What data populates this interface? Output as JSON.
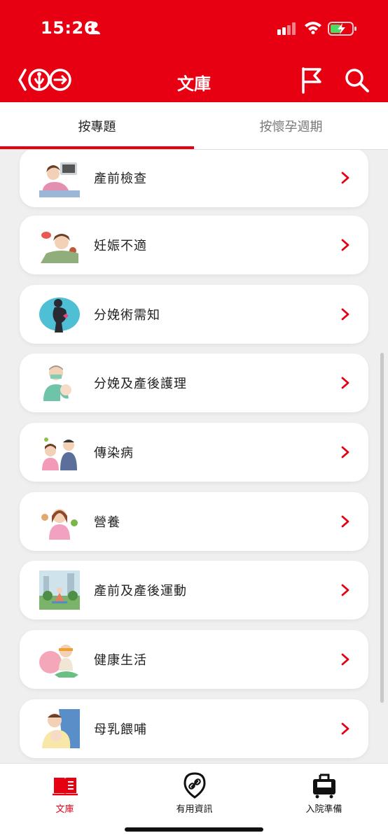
{
  "status_bar": {
    "time": "15:26"
  },
  "nav": {
    "title": "文庫"
  },
  "tabs": [
    {
      "label": "按專題"
    },
    {
      "label": "按懷孕週期"
    }
  ],
  "topics": [
    {
      "label": "產前檢查",
      "icon": "prenatal-checkup-illustration"
    },
    {
      "label": "妊娠不適",
      "icon": "pregnancy-discomfort-illustration"
    },
    {
      "label": "分娩術需知",
      "icon": "childbirth-illustration"
    },
    {
      "label": "分娩及產後護理",
      "icon": "postnatal-care-illustration"
    },
    {
      "label": "傳染病",
      "icon": "infectious-disease-illustration"
    },
    {
      "label": "營養",
      "icon": "nutrition-illustration"
    },
    {
      "label": "產前及產後運動",
      "icon": "exercise-illustration"
    },
    {
      "label": "健康生活",
      "icon": "healthy-living-illustration"
    },
    {
      "label": "母乳餵哺",
      "icon": "breastfeeding-illustration"
    }
  ],
  "tabbar": [
    {
      "label": "文庫",
      "icon": "book-icon"
    },
    {
      "label": "有用資訊",
      "icon": "link-icon"
    },
    {
      "label": "入院準備",
      "icon": "luggage-icon"
    }
  ],
  "colors": {
    "brand_red": "#e60012",
    "background": "#efefef",
    "card": "#ffffff"
  }
}
